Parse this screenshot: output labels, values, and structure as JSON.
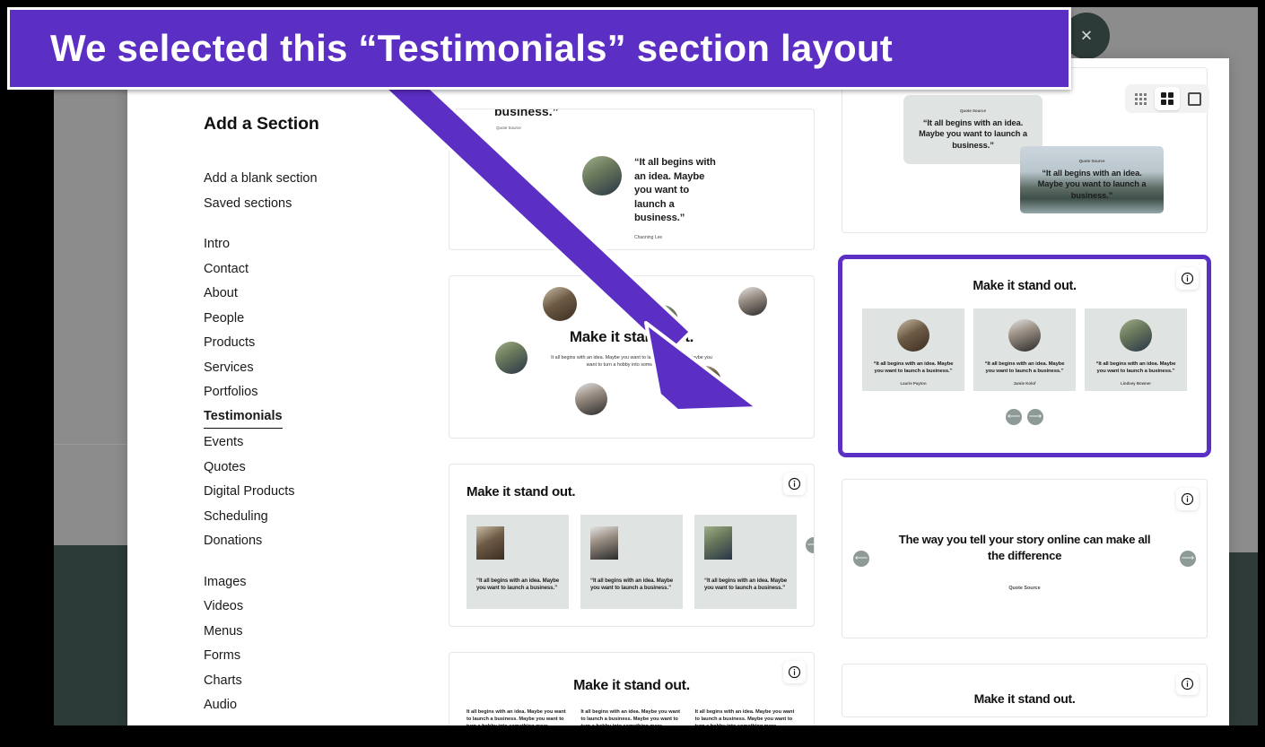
{
  "annotation": {
    "banner_text": "We selected this “Testimonials” section layout",
    "banner_color": "#5b2ec4",
    "arrow_color": "#5b2ec4",
    "arrow_label": "arrow-pointing-to-selected-layout"
  },
  "toolbar": {
    "density_options": [
      {
        "name": "compact-grid",
        "icon": "dots-grid-icon",
        "selected": false
      },
      {
        "name": "medium-grid",
        "icon": "four-square-grid-icon",
        "selected": true
      },
      {
        "name": "single-column",
        "icon": "single-frame-icon",
        "selected": false
      }
    ],
    "close_button_icon": "close-icon"
  },
  "sidebar": {
    "title": "Add a Section",
    "group_primary": [
      {
        "label": "Add a blank section"
      },
      {
        "label": "Saved sections"
      }
    ],
    "group_sections": [
      {
        "label": "Intro"
      },
      {
        "label": "Contact"
      },
      {
        "label": "About"
      },
      {
        "label": "People"
      },
      {
        "label": "Products"
      },
      {
        "label": "Services"
      },
      {
        "label": "Portfolios"
      },
      {
        "label": "Testimonials",
        "selected": true
      },
      {
        "label": "Events"
      },
      {
        "label": "Quotes"
      },
      {
        "label": "Digital Products"
      },
      {
        "label": "Scheduling"
      },
      {
        "label": "Donations"
      }
    ],
    "group_media": [
      {
        "label": "Images"
      },
      {
        "label": "Videos"
      },
      {
        "label": "Menus"
      },
      {
        "label": "Forms"
      },
      {
        "label": "Charts"
      },
      {
        "label": "Audio"
      }
    ]
  },
  "gallery": {
    "info_icon": "info-circle-icon",
    "prev_icon": "arrow-left-icon",
    "next_icon": "arrow-right-icon",
    "quote_text": "“It all begins with an idea. Maybe you want to launch a business.”",
    "quote_source_label": "Quote Source",
    "cards": [
      {
        "name": "layout-quote-with-portrait",
        "clipped_heading": "business.”",
        "quote": "“It all begins with an idea. Maybe you want to launch a business.”",
        "author": "Chaoning Lee",
        "selected": false
      },
      {
        "name": "layout-scattered-avatars",
        "heading": "Make it stand out.",
        "body": "It all begins with an idea. Maybe you want to launch a business. Maybe you want to turn a hobby into something more.",
        "selected": false
      },
      {
        "name": "layout-left-heading-three-tiles",
        "heading": "Make it stand out.",
        "tiles": [
          {
            "quote": "“It all begins with an idea. Maybe you want to launch a business.”"
          },
          {
            "quote": "“It all begins with an idea. Maybe you want to launch a business.”"
          },
          {
            "quote": "“It all begins with an idea. Maybe you want to launch a business.”"
          }
        ],
        "selected": false
      },
      {
        "name": "layout-centered-heading-three-columns",
        "heading": "Make it stand out.",
        "columns": [
          "It all begins with an idea. Maybe you want to launch a business. Maybe you want to turn a hobby into something more.",
          "It all begins with an idea. Maybe you want to launch a business. Maybe you want to turn a hobby into something more.",
          "It all begins with an idea. Maybe you want to launch a business. Maybe you want to turn a hobby into something more."
        ],
        "selected": false
      },
      {
        "name": "layout-overlapping-quote-cards",
        "card_a": {
          "source": "Quote Source",
          "quote": "“It all begins with an idea. Maybe you want to launch a business.”"
        },
        "card_b": {
          "source": "Quote Source",
          "quote": "“It all begins with an idea. Maybe you want to launch a business.”"
        },
        "selected": false
      },
      {
        "name": "layout-testimonial-carousel-three-up",
        "heading": "Make it stand out.",
        "tiles": [
          {
            "quote": "“It all begins with an idea. Maybe you want to launch a business.”",
            "author": "Laurie Payton"
          },
          {
            "quote": "“It all begins with an idea. Maybe you want to launch a business.”",
            "author": "Jamie Kolof"
          },
          {
            "quote": "“It all begins with an idea. Maybe you want to launch a business.”",
            "author": "Lindsey Bowner"
          }
        ],
        "selected": true
      },
      {
        "name": "layout-big-centered-quote",
        "heading": "The way you tell your story online can make all the difference",
        "source": "Quote Source",
        "selected": false
      },
      {
        "name": "layout-clipped-bottom",
        "heading": "Make it stand out.",
        "selected": false
      }
    ]
  }
}
